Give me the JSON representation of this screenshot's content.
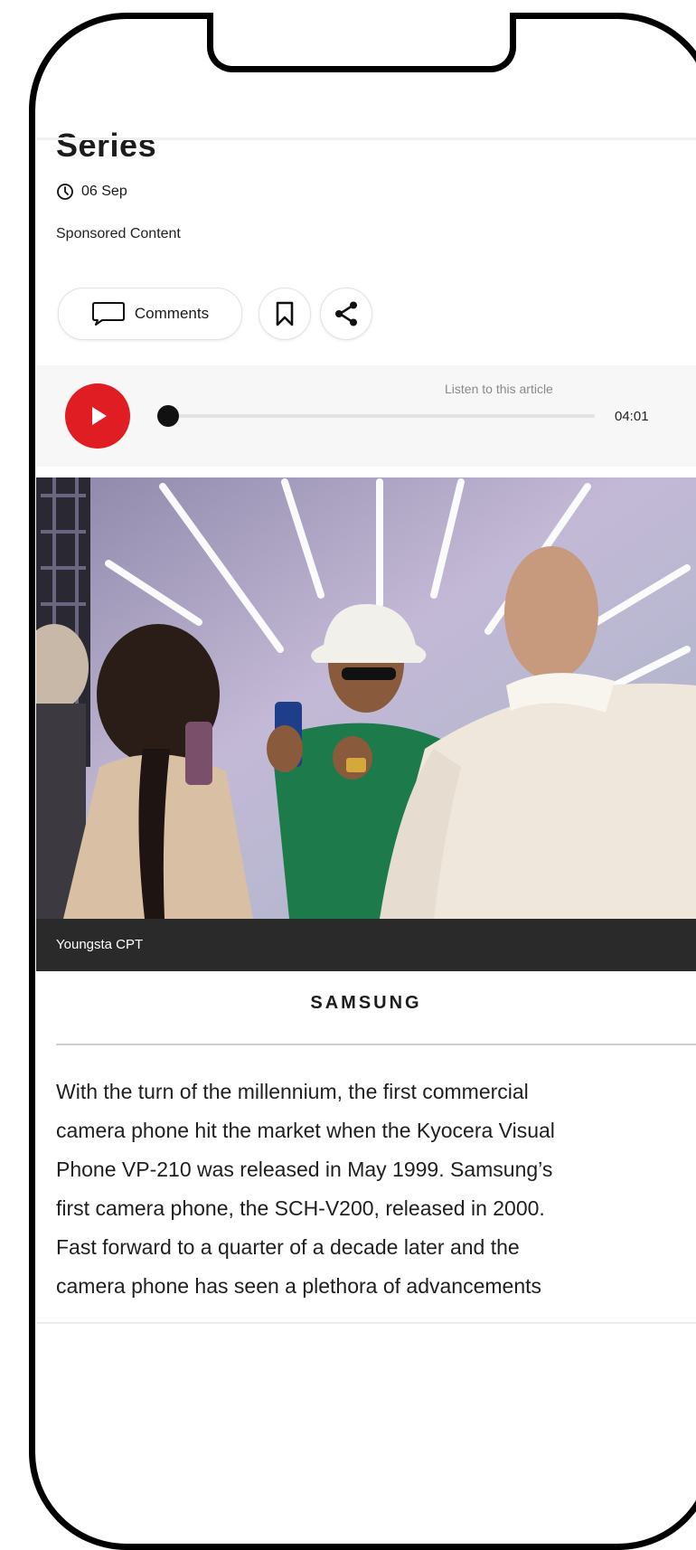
{
  "article": {
    "title_fragment": "Series",
    "date": "06 Sep",
    "label": "Sponsored Content"
  },
  "actions": {
    "comments_label": "Comments"
  },
  "audio_player": {
    "prompt": "Listen to this article",
    "duration": "04:01",
    "progress": 0.0
  },
  "image": {
    "caption": "Youngsta CPT"
  },
  "brand": {
    "name": "SAMSUNG"
  },
  "body": {
    "lines": [
      "With the turn of the millennium, the first commercial",
      "camera phone hit the market when the Kyocera Visual",
      "Phone VP-210 was released in May 1999. Samsung’s",
      "first camera phone, the SCH-V200, released in 2000.",
      "Fast forward to a quarter of a decade later and the",
      "camera phone has seen a plethora of advancements"
    ]
  },
  "colors": {
    "accent": "#e11d24",
    "caption_bg": "#2a2a2a",
    "audio_bg": "#f7f7f7"
  },
  "icons": [
    "clock-icon",
    "comment-icon",
    "bookmark-icon",
    "share-icon",
    "play-icon"
  ]
}
